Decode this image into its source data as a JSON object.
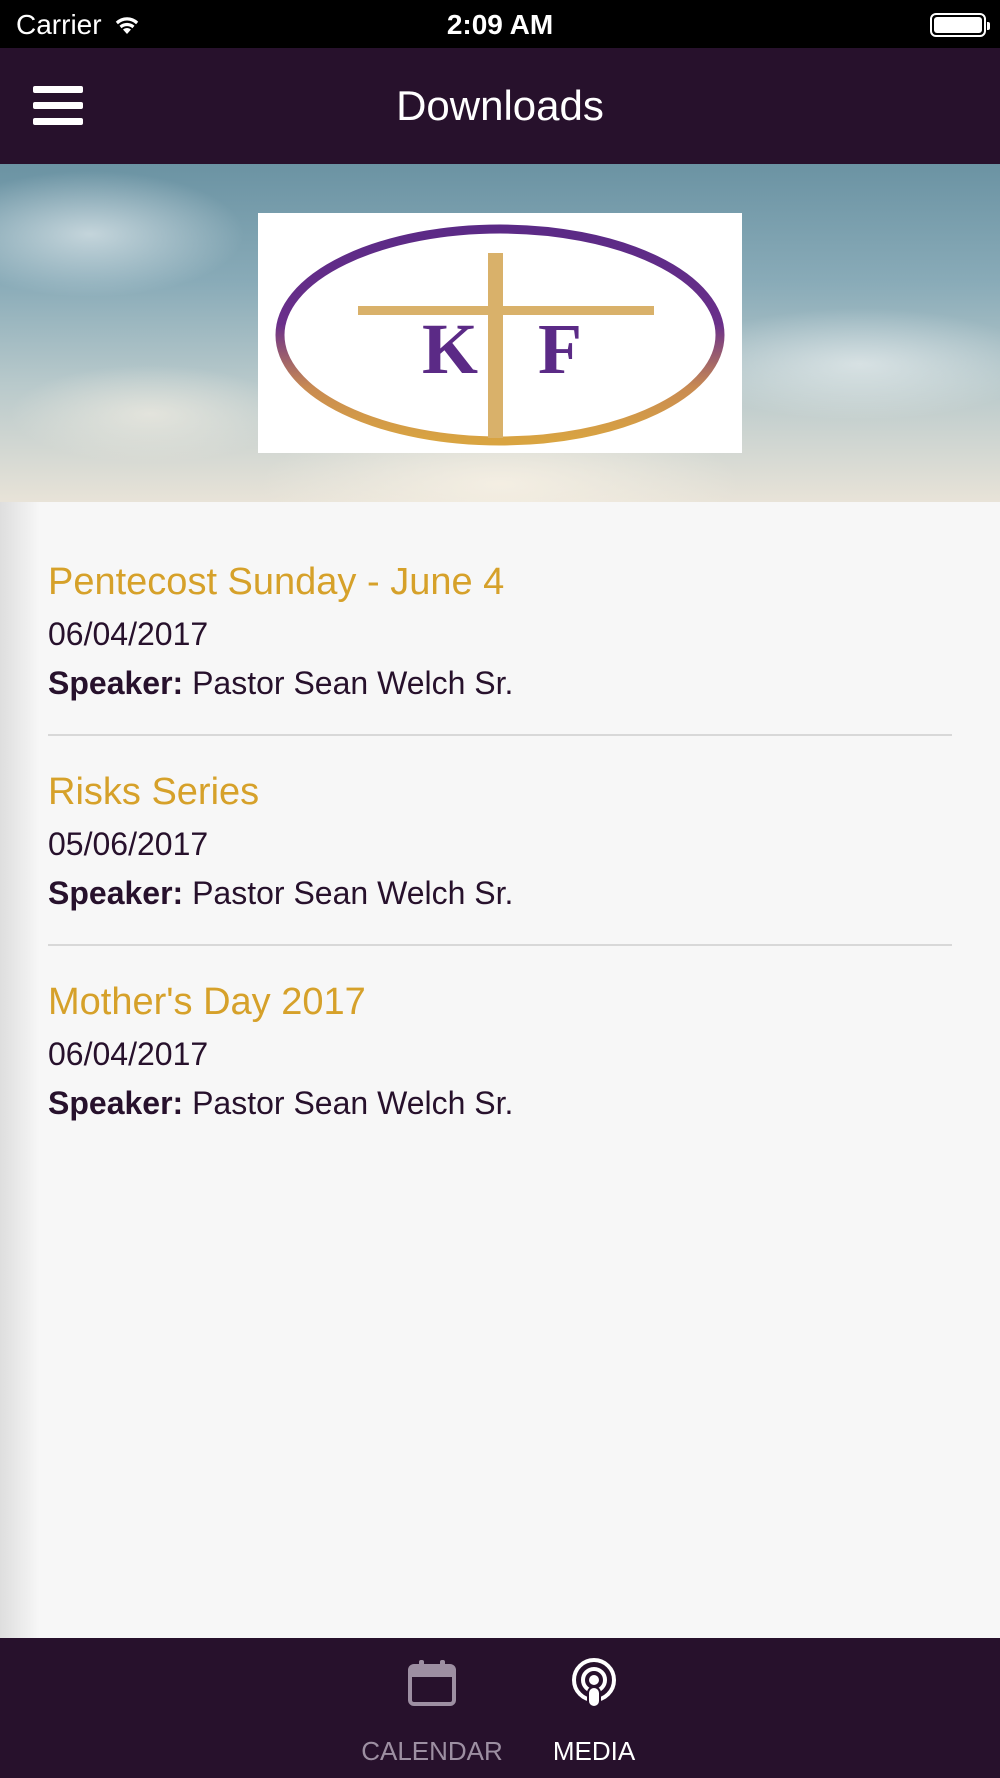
{
  "status_bar": {
    "carrier": "Carrier",
    "time": "2:09 AM"
  },
  "nav": {
    "title": "Downloads"
  },
  "logo": {
    "letters": "KF"
  },
  "sermons": [
    {
      "title": "Pentecost Sunday - June 4",
      "date": "06/04/2017",
      "speaker_label": "Speaker:",
      "speaker": "Pastor Sean Welch Sr."
    },
    {
      "title": "Risks Series",
      "date": "05/06/2017",
      "speaker_label": "Speaker:",
      "speaker": "Pastor Sean Welch Sr."
    },
    {
      "title": "Mother's Day 2017",
      "date": "06/04/2017",
      "speaker_label": "Speaker:",
      "speaker": "Pastor Sean Welch Sr."
    }
  ],
  "tabs": [
    {
      "label": "CALENDAR",
      "icon": "calendar-icon",
      "selected": false
    },
    {
      "label": "MEDIA",
      "icon": "podcast-icon",
      "selected": true
    }
  ],
  "colors": {
    "primary": "#27112c",
    "accent": "#d6a12a",
    "background": "#f7f7f7",
    "logo_purple": "#5b2a86",
    "logo_gold": "#d9a441"
  }
}
